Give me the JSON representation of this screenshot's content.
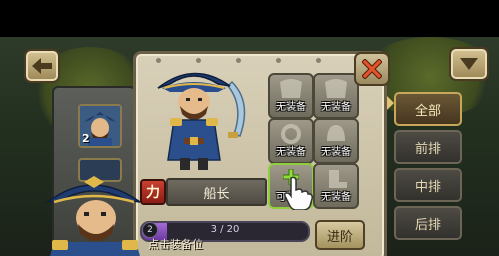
{
  "hero": {
    "name": "船长",
    "attribute_badge": "力",
    "attribute_color": "#c94030"
  },
  "equipment": {
    "slots": [
      {
        "label": "无装备",
        "state": "empty"
      },
      {
        "label": "无装备",
        "state": "empty"
      },
      {
        "label": "无装备",
        "state": "empty"
      },
      {
        "label": "无装备",
        "state": "empty"
      },
      {
        "label": "可装备",
        "state": "equippable"
      },
      {
        "label": "无装备",
        "state": "empty"
      }
    ]
  },
  "progress": {
    "level": "2",
    "text": "3 / 20",
    "current": 3,
    "max": 20
  },
  "buttons": {
    "advance": "进阶"
  },
  "hint": "点击装备位",
  "roster": {
    "items": [
      {
        "badge": "2"
      }
    ]
  },
  "filter_tabs": [
    {
      "label": "全部",
      "active": true
    },
    {
      "label": "前排",
      "active": false
    },
    {
      "label": "中排",
      "active": false
    },
    {
      "label": "后排",
      "active": false
    }
  ],
  "icons": {
    "back": "back-arrow-icon",
    "menu": "dropdown-arrow-icon",
    "close": "close-x-icon",
    "pointer": "pointing-hand-icon"
  },
  "colors": {
    "panel": "#d8d0b8",
    "tab_active": "#c9a75a",
    "xp_fill": "#a66ad6",
    "close": "#e2542a"
  }
}
